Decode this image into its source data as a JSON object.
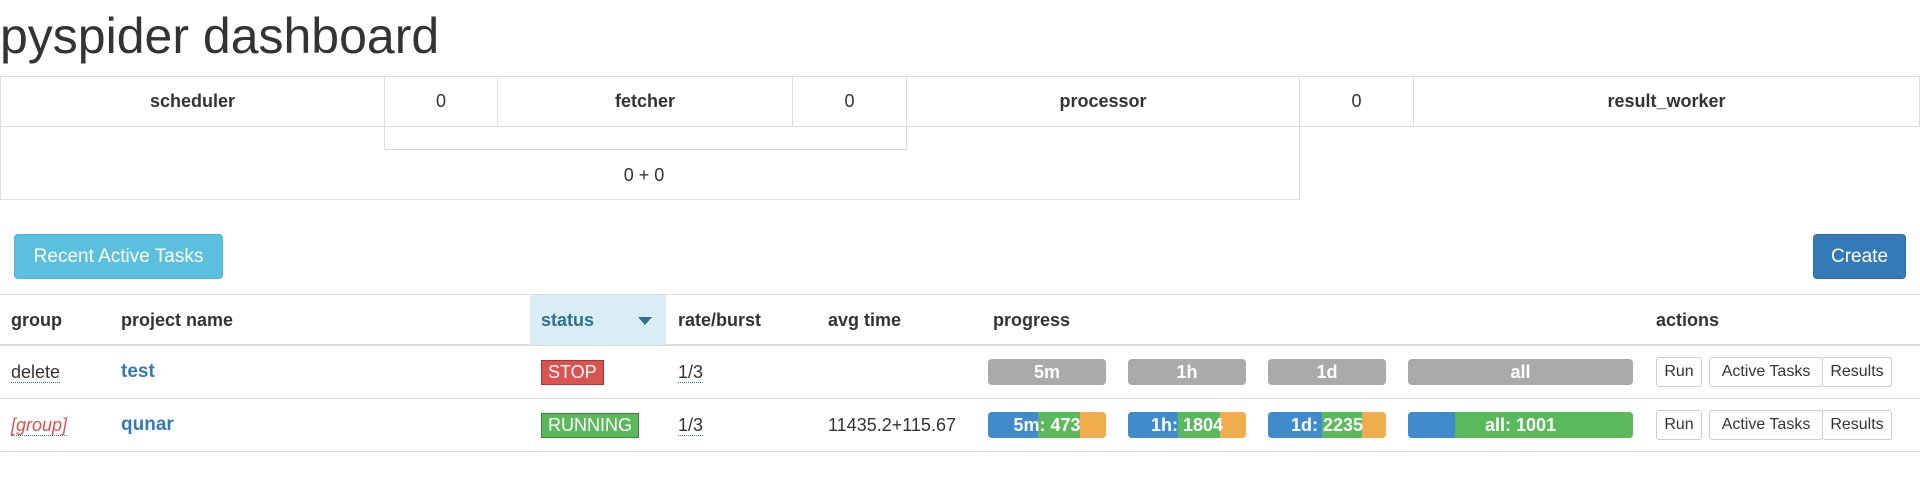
{
  "page": {
    "title": "pyspider dashboard"
  },
  "stats": {
    "scheduler": {
      "label": "scheduler",
      "count": "0"
    },
    "fetcher": {
      "label": "fetcher",
      "count": "0"
    },
    "processor": {
      "label": "processor",
      "count": "0"
    },
    "result_worker": {
      "label": "result_worker"
    },
    "processor_summary": "0 + 0"
  },
  "toolbar": {
    "recent_active_tasks": "Recent Active Tasks",
    "create": "Create"
  },
  "table": {
    "headers": {
      "group": "group",
      "project_name": "project name",
      "status": "status",
      "rate_burst": "rate/burst",
      "avg_time": "avg time",
      "progress": "progress",
      "actions": "actions"
    },
    "rows": [
      {
        "group": "delete",
        "name": "test",
        "status": "STOP",
        "rate_burst": "1/3",
        "avg_time": "",
        "progress": {
          "5m": {
            "label": "5m",
            "fractions": [
              0,
              0,
              0
            ]
          },
          "1h": {
            "label": "1h",
            "fractions": [
              0,
              0,
              0
            ]
          },
          "1d": {
            "label": "1d",
            "fractions": [
              0,
              0,
              0
            ]
          },
          "all": {
            "label": "all",
            "fractions": [
              0,
              0,
              0
            ]
          }
        },
        "actions": {
          "run": "Run",
          "active_tasks": "Active Tasks",
          "results": "Results"
        }
      },
      {
        "group": "[group]",
        "name": "qunar",
        "status": "RUNNING",
        "rate_burst": "1/3",
        "avg_time": "11435.2+115.67",
        "progress": {
          "5m": {
            "label": "5m: 473",
            "fractions": [
              0.42,
              0.36,
              0.22
            ]
          },
          "1h": {
            "label": "1h: 1804",
            "fractions": [
              0.42,
              0.36,
              0.22
            ]
          },
          "1d": {
            "label": "1d: 2235",
            "fractions": [
              0.46,
              0.34,
              0.2
            ]
          },
          "all": {
            "label": "all: 1001",
            "fractions": [
              0.21,
              0.79,
              0
            ]
          }
        },
        "actions": {
          "run": "Run",
          "active_tasks": "Active Tasks",
          "results": "Results"
        }
      }
    ]
  },
  "colors": {
    "blue": "#428bca",
    "green": "#5cb85c",
    "orange": "#f0ad4e",
    "gray": "#aaaaaa",
    "danger": "#d9534f"
  }
}
